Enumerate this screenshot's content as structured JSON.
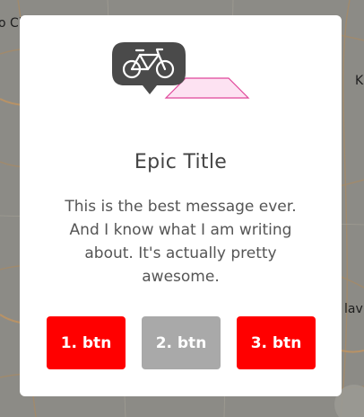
{
  "map": {
    "labels": [
      "o Cl",
      "K",
      "lav"
    ]
  },
  "dialog": {
    "icon": "bicycle-icon",
    "illustration": "pink-shape",
    "title": "Epic Title",
    "message": "This is the best message ever. And I know what I am writing about. It's actually pretty awesome.",
    "buttons": [
      {
        "label": "1. btn",
        "color": "#ff0000"
      },
      {
        "label": "2. btn",
        "color": "#a9a9a9"
      },
      {
        "label": "3. btn",
        "color": "#ff0000"
      }
    ]
  },
  "colors": {
    "backdrop": "#8a8a86",
    "icon_bubble": "#4a4a4a",
    "pink_fill": "#fde2f2",
    "pink_stroke": "#e0469a"
  }
}
